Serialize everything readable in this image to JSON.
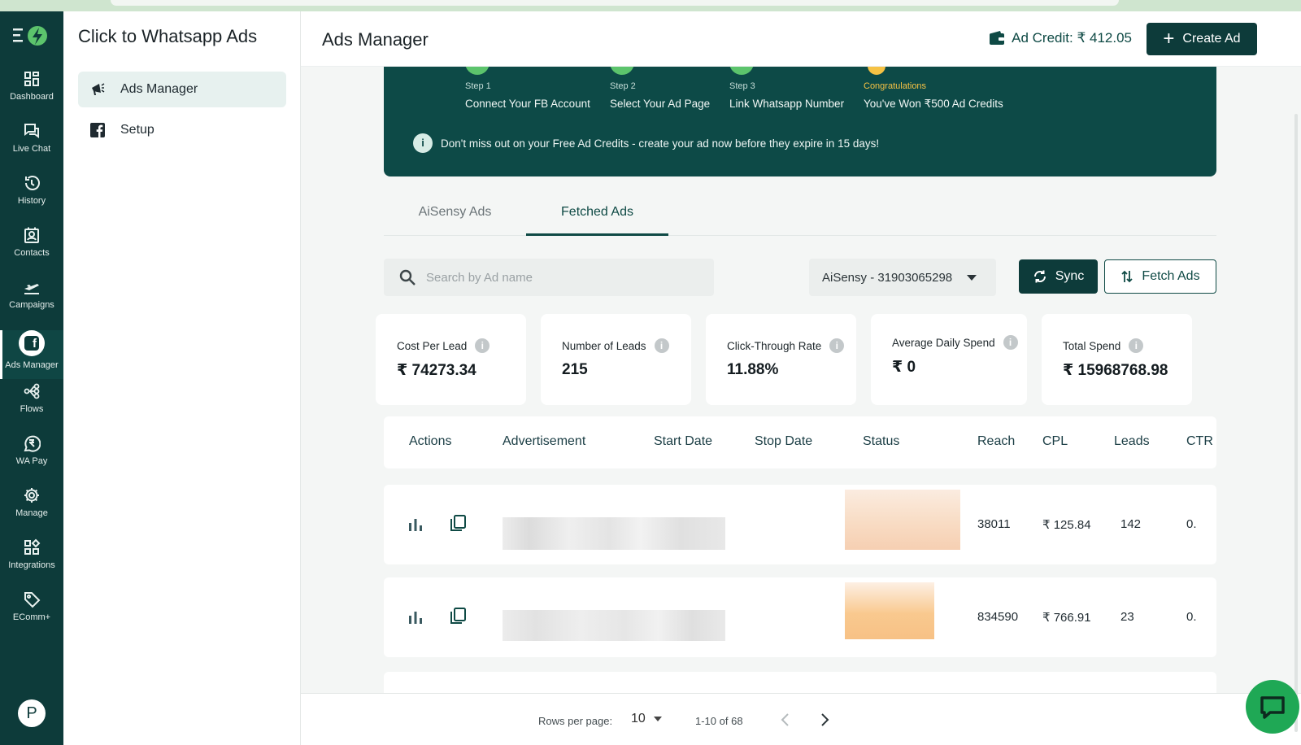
{
  "app": {
    "brand_color": "#0d3b3a",
    "accent_color": "#0f4a45"
  },
  "rail": {
    "items": [
      {
        "label": "Dashboard",
        "icon": "dashboard-icon"
      },
      {
        "label": "Live Chat",
        "icon": "chat-icon"
      },
      {
        "label": "History",
        "icon": "history-icon"
      },
      {
        "label": "Contacts",
        "icon": "contacts-icon"
      },
      {
        "label": "Campaigns",
        "icon": "campaigns-icon"
      },
      {
        "label": "Ads Manager",
        "icon": "facebook-icon",
        "active": true
      },
      {
        "label": "Flows",
        "icon": "flows-icon"
      },
      {
        "label": "WA Pay",
        "icon": "rupee-icon"
      },
      {
        "label": "Manage",
        "icon": "gear-icon"
      },
      {
        "label": "Integrations",
        "icon": "integrations-icon"
      },
      {
        "label": "EComm+",
        "icon": "tag-icon"
      }
    ],
    "avatar_initial": "P"
  },
  "subnav": {
    "title": "Click to Whatsapp Ads",
    "items": [
      {
        "label": "Ads Manager",
        "icon": "megaphone-icon",
        "active": true
      },
      {
        "label": "Setup",
        "icon": "facebook-icon"
      }
    ]
  },
  "header": {
    "title": "Ads Manager",
    "credit_label": "Ad Credit: ₹ 412.05",
    "create_label": "Create Ad"
  },
  "banner": {
    "steps": [
      {
        "small": "Step 1",
        "main": "Connect Your FB Account"
      },
      {
        "small": "Step 2",
        "main": "Select Your Ad Page"
      },
      {
        "small": "Step 3",
        "main": "Link Whatsapp Number"
      },
      {
        "small": "Congratulations",
        "main": "You've Won ₹500 Ad Credits"
      }
    ],
    "notice": "Don't miss out on your Free Ad Credits - create your ad now before they expire in 15 days!"
  },
  "tabs": [
    {
      "label": "AiSensy Ads",
      "active": false
    },
    {
      "label": "Fetched Ads",
      "active": true
    }
  ],
  "filters": {
    "search_placeholder": "Search by Ad name",
    "account": "AiSensy - 31903065298",
    "sync_label": "Sync",
    "fetch_label": "Fetch Ads"
  },
  "stats": [
    {
      "label": "Cost Per Lead",
      "value": "₹ 74273.34"
    },
    {
      "label": "Number of Leads",
      "value": "215"
    },
    {
      "label": "Click-Through Rate",
      "value": "11.88%"
    },
    {
      "label": "Average Daily Spend",
      "value": "₹ 0"
    },
    {
      "label": "Total Spend",
      "value": "₹ 15968768.98"
    }
  ],
  "table": {
    "columns": [
      "Actions",
      "Advertisement",
      "Start Date",
      "Stop Date",
      "Status",
      "Reach",
      "CPL",
      "Leads",
      "CTR"
    ],
    "rows": [
      {
        "reach": "38011",
        "cpl": "₹ 125.84",
        "leads": "142",
        "ctr": "0."
      },
      {
        "reach": "834590",
        "cpl": "₹ 766.91",
        "leads": "23",
        "ctr": "0."
      }
    ]
  },
  "pagination": {
    "rows_per_page_label": "Rows per page:",
    "rows_per_page": "10",
    "range": "1-10 of 68"
  }
}
